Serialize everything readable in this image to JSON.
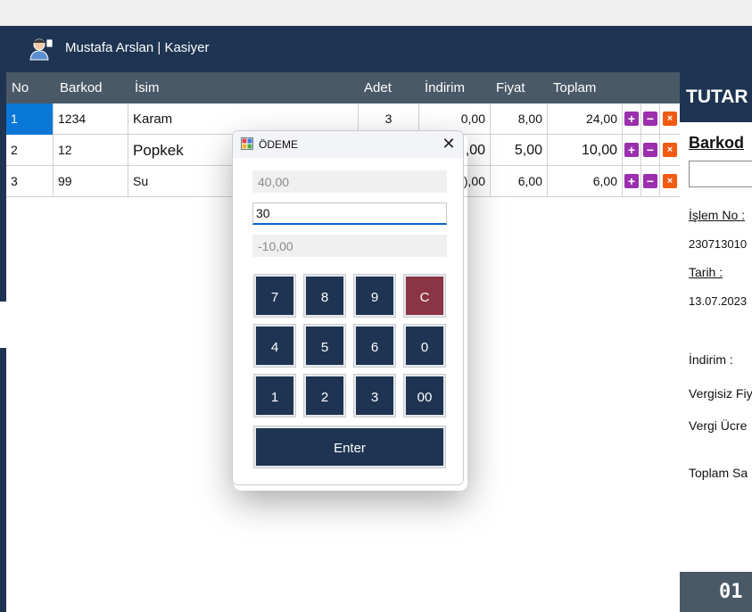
{
  "header": {
    "user_label": "Mustafa Arslan | Kasiyer"
  },
  "grid": {
    "columns": [
      "No",
      "Barkod",
      "İsim",
      "Adet",
      "İndirim",
      "Fiyat",
      "Toplam"
    ],
    "rows": [
      {
        "no": "1",
        "barkod": "1234",
        "isim": "Karam",
        "adet": "3",
        "indirim": "0,00",
        "fiyat": "8,00",
        "toplam": "24,00"
      },
      {
        "no": "2",
        "barkod": "12",
        "isim": "Popkek",
        "adet": "",
        "indirim": ",00",
        "fiyat": "5,00",
        "toplam": "10,00"
      },
      {
        "no": "3",
        "barkod": "99",
        "isim": "Su",
        "adet": "",
        "indirim": "),00",
        "fiyat": "6,00",
        "toplam": "6,00"
      }
    ],
    "row_actions": {
      "add": "+",
      "remove": "−",
      "delete": "×"
    }
  },
  "right_panel": {
    "tutar": "TUTAR",
    "barkod_label": "Barkod",
    "islem_no_label": "İşlem No :",
    "islem_no_value": "230713010",
    "tarih_label": "Tarih :",
    "tarih_value": "13.07.2023",
    "indirim_label": "İndirim :",
    "vergisiz_label": "Vergisiz Fiy",
    "vergi_label": "Vergi Ücre",
    "toplam_label": "Toplam Sa",
    "total_display": "01"
  },
  "dialog": {
    "title": "ÖDEME",
    "close_label": "✕",
    "total_field": "40,00",
    "paid_field": "30",
    "change_field": "-10,00",
    "keys": [
      "7",
      "8",
      "9",
      "C",
      "4",
      "5",
      "6",
      "0",
      "1",
      "2",
      "3",
      "00"
    ],
    "enter_label": "Enter"
  },
  "colors": {
    "navy": "#1f3452",
    "grid_header": "#4a5968",
    "selected": "#0a78d7",
    "clear_key": "#8a3446",
    "action_purple": "#9b2fae",
    "action_orange": "#f25a12"
  }
}
